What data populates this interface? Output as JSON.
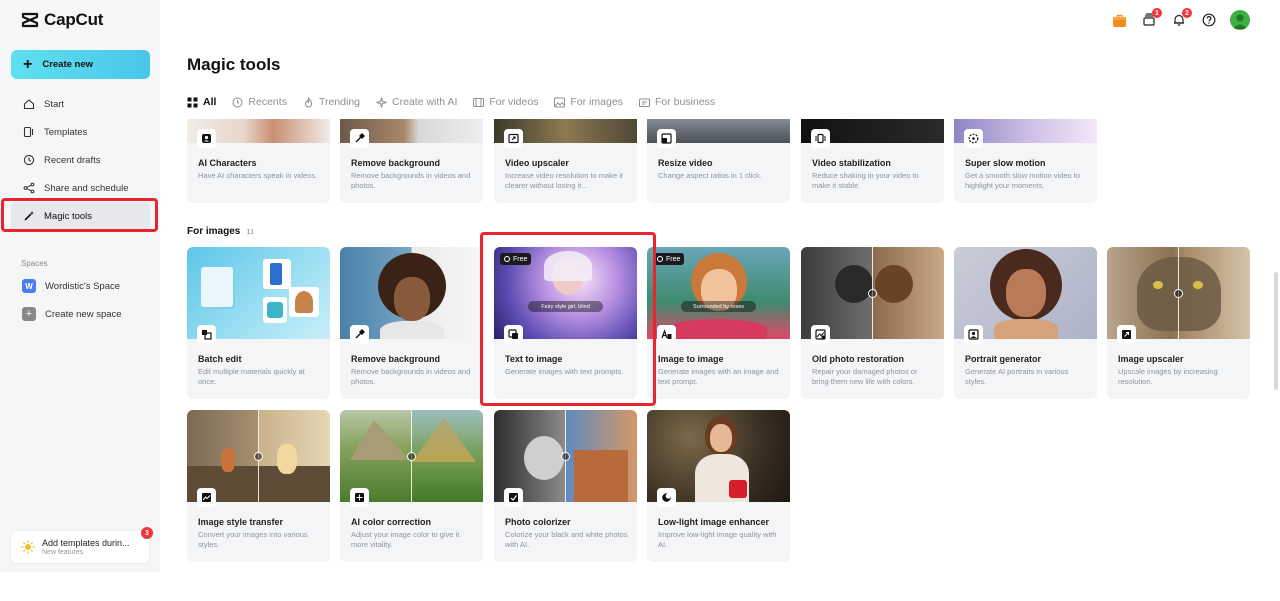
{
  "app": {
    "name": "CapCut"
  },
  "sidebar": {
    "create_label": "Create new",
    "nav": [
      {
        "label": "Start",
        "icon": "home-icon"
      },
      {
        "label": "Templates",
        "icon": "templates-icon"
      },
      {
        "label": "Recent drafts",
        "icon": "clock-icon"
      },
      {
        "label": "Share and schedule",
        "icon": "share-icon"
      },
      {
        "label": "Magic tools",
        "icon": "magic-wand-icon",
        "active": true
      }
    ],
    "spaces_label": "Spaces",
    "spaces": [
      {
        "label": "Wordistic's Space",
        "badge": "W"
      },
      {
        "label": "Create new space",
        "badge": "+"
      }
    ],
    "promo": {
      "title": "Add templates durin...",
      "subtitle": "New features",
      "badge": "3"
    }
  },
  "topbar": {
    "queue_badge": "1",
    "notifications_badge": "2"
  },
  "page_title": "Magic tools",
  "tabs": [
    {
      "label": "All",
      "active": true
    },
    {
      "label": "Recents"
    },
    {
      "label": "Trending"
    },
    {
      "label": "Create with AI"
    },
    {
      "label": "For videos"
    },
    {
      "label": "For images"
    },
    {
      "label": "For business"
    }
  ],
  "video_tools": [
    {
      "title": "AI Characters",
      "desc": "Have AI characters speak in videos."
    },
    {
      "title": "Remove background",
      "desc": "Remove backgrounds in videos and photos."
    },
    {
      "title": "Video upscaler",
      "desc": "Increase video resolution to make it clearer without losing it..."
    },
    {
      "title": "Resize video",
      "desc": "Change aspect ratios in 1 click."
    },
    {
      "title": "Video stabilization",
      "desc": "Reduce shaking in your video to make it stable."
    },
    {
      "title": "Super slow motion",
      "desc": "Get a smooth slow motion video to highlight your moments."
    }
  ],
  "images_section": {
    "label": "For images",
    "count": "11"
  },
  "image_tools": [
    {
      "title": "Batch edit",
      "desc": "Edit multiple materials quickly at once."
    },
    {
      "title": "Remove background",
      "desc": "Remove backgrounds in videos and photos."
    },
    {
      "title": "Text to image",
      "desc": "Generate images with text prompts.",
      "free": "Free",
      "prompt": "Fairy style girl, blind"
    },
    {
      "title": "Image to image",
      "desc": "Generate images with an image and text prompt.",
      "free": "Free",
      "prompt": "Surrounded by roses"
    },
    {
      "title": "Old photo restoration",
      "desc": "Repair your damaged photos or bring them new life with colors."
    },
    {
      "title": "Portrait generator",
      "desc": "Generate AI portraits in various styles."
    },
    {
      "title": "Image upscaler",
      "desc": "Upscale images by increasing resolution."
    },
    {
      "title": "Image style transfer",
      "desc": "Convert your images into various styles."
    },
    {
      "title": "AI color correction",
      "desc": "Adjust your image color to give it more vitality."
    },
    {
      "title": "Photo colorizer",
      "desc": "Colorize your black and white photos with AI."
    },
    {
      "title": "Low-light image enhancer",
      "desc": "Improve low-light image quality with AI."
    }
  ]
}
